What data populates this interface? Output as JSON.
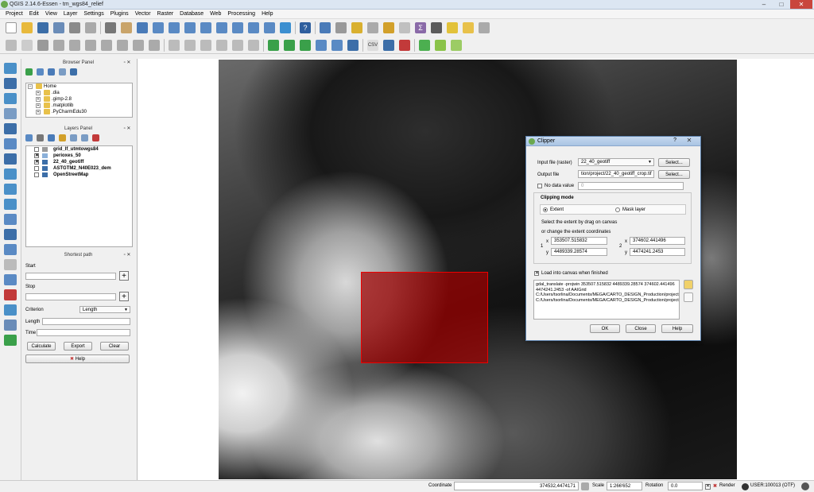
{
  "window": {
    "title": "QGIS 2.14.6-Essen - tm_wgs84_relief"
  },
  "menu": [
    "Project",
    "Edit",
    "View",
    "Layer",
    "Settings",
    "Plugins",
    "Vector",
    "Raster",
    "Database",
    "Web",
    "Processing",
    "Help"
  ],
  "browser_panel": {
    "title": "Browser Panel",
    "items": [
      {
        "label": "Home",
        "expand": "−"
      },
      {
        "label": ".dia",
        "expand": "+"
      },
      {
        "label": ".gimp-2.8",
        "expand": "+"
      },
      {
        "label": ".matplotlib",
        "expand": "+"
      },
      {
        "label": ".PyCharmEdu30",
        "expand": "+"
      }
    ]
  },
  "layers_panel": {
    "title": "Layers Panel",
    "layers": [
      {
        "label": "grid_lf_utmtowgs84",
        "checked": false,
        "icon": "line-layer-icon",
        "color": "#9a9a9a"
      },
      {
        "label": "perioxes_50",
        "checked": true,
        "icon": "polygon-layer-icon",
        "color": "#8bb0d9"
      },
      {
        "label": "22_40_geotiff",
        "checked": true,
        "icon": "raster-layer-icon",
        "color": "#3c6ea8"
      },
      {
        "label": "ASTGTM2_N40E023_dem",
        "checked": false,
        "icon": "raster-layer-icon",
        "color": "#3c6ea8"
      },
      {
        "label": "OpenStreetMap",
        "checked": false,
        "icon": "raster-layer-icon",
        "color": "#3c6ea8"
      }
    ]
  },
  "shortest_path": {
    "title": "Shortest path",
    "start_label": "Start",
    "stop_label": "Stop",
    "criterion_label": "Criterion",
    "criterion_value": "Length",
    "length_label": "Length",
    "time_label": "Time",
    "calculate_label": "Calculate",
    "export_label": "Export",
    "clear_label": "Clear",
    "help_label": "Help"
  },
  "clipper": {
    "title": "Clipper",
    "help_glyph": "?",
    "close_glyph": "✕",
    "input_label": "Input file (raster)",
    "input_value": "22_40_geotiff",
    "select_label": "Select...",
    "output_label": "Output file",
    "output_value": "tion/project/22_40_geotiff_crop.tif",
    "nodata_label": "No data value",
    "nodata_value": "0",
    "mode_title": "Clipping mode",
    "extent_label": "Extent",
    "mask_label": "Mask layer",
    "hint1": "Select the extent by drag on canvas",
    "hint2": "or change the extent coordinates",
    "x_label": "x",
    "y_label": "y",
    "p1": "1",
    "p2": "2",
    "x1": "353507.515832",
    "y1": "4489339.28574",
    "x2": "374602.441496",
    "y2": "4474241.2453",
    "load_label": "Load into canvas when finished",
    "command": "gdal_translate -projwin 353507.515832 4489339.28574 374602.441496 4474241.2453 -of AAIGrid C:/Users/tsorlina/Documents/MEGA/CARTO_DESIGN_Production/project/22_40_geotiff.tif C:/Users/tsorlina/Documents/MEGA/CARTO_DESIGN_Production/project/22_40_geotiff_crop.tif",
    "ok_label": "OK",
    "close_label": "Close",
    "help_label": "Help"
  },
  "status": {
    "coordinate_label": "Coordinate",
    "coordinate_value": "374532,4474171",
    "scale_label": "Scale",
    "scale_value": "1:266'652",
    "rotation_label": "Rotation",
    "rotation_value": "0.0",
    "render_label": "Render",
    "crs_label": "USER:100013 (OTF)"
  },
  "colors": {
    "selection_box": "#a00000",
    "accent": "#3c6ea8"
  }
}
